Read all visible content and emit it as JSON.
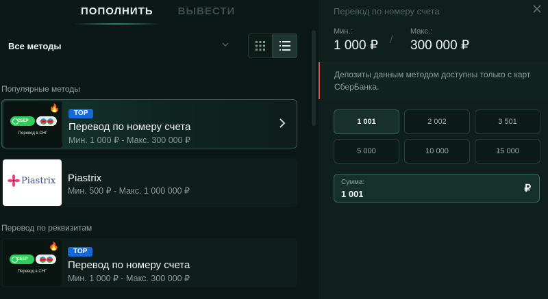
{
  "tabs": [
    {
      "label": "ПОПОЛНИТЬ",
      "active": true
    },
    {
      "label": "ВЫВЕСТИ",
      "active": false
    }
  ],
  "filter": {
    "selected": "Все методы"
  },
  "sections": {
    "popular": "Популярные методы",
    "requisites": "Перевод по реквизитам"
  },
  "cards": [
    {
      "badge": "TOP",
      "name": "Перевод по номеру счета",
      "limits": "Мин. 1 000 ₽ - Макс. 300 000 ₽",
      "logo_pill": "СБЕР",
      "logo_caption": "Перевод в СНГ"
    },
    {
      "name": "Piastrix",
      "limits": "Мин. 500 ₽ - Макс. 1 000 000 ₽",
      "logo_word": "Piastrix"
    },
    {
      "badge": "TOP",
      "name": "Перевод по номеру счета",
      "limits": "Мин. 1 000 ₽ - Макс. 300 000 ₽",
      "logo_pill": "СБЕР",
      "logo_caption": "Перевод в СНГ"
    }
  ],
  "panel": {
    "title": "Перевод по номеру счета",
    "min_label": "Мин.:",
    "min_value": "1 000 ₽",
    "max_label": "Макс.:",
    "max_value": "300 000 ₽",
    "separator": "/",
    "notice": "Депозиты данным методом доступны только с карт СберБанка.",
    "amounts": [
      "1 001",
      "2 002",
      "3 501",
      "5 000",
      "10 000",
      "15 000"
    ],
    "selected_amount_index": 0,
    "amount_label": "Сумма:",
    "amount_value": "1 001",
    "currency": "₽"
  },
  "icons": {
    "close": "close-icon",
    "grid": "grid-view-icon",
    "list": "list-view-icon",
    "chevron": "chevron-down-icon",
    "arrow": "chevron-right-icon",
    "fire": "fire-icon"
  },
  "colors": {
    "accent": "#3fd0a6",
    "top_badge": "#1769d6",
    "notice_border": "#d9534f"
  }
}
